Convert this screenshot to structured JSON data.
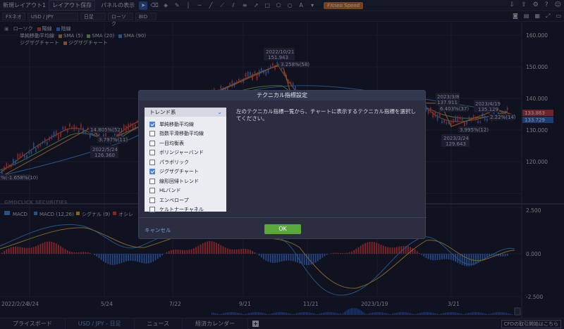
{
  "toolbar": {
    "layout_name": "新規レイアウト1",
    "save_layout": "レイアウト保存",
    "panel_display": "パネルの表示",
    "fxneo_speed": "FXneo Speed",
    "tools": [
      "cursor-icon",
      "eraser-icon",
      "paint-icon",
      "draw-icon",
      "vline-icon",
      "hline-icon",
      "trendline-icon",
      "ray-icon",
      "channel-icon",
      "parallel-icon",
      "arrow-icon",
      "rect-icon",
      "pentagon-icon",
      "circle-icon",
      "text-icon",
      "chevron-down-icon"
    ],
    "right_icons": [
      "download-icon",
      "share-icon",
      "gear-icon",
      "question-icon",
      "user-icon"
    ]
  },
  "subbar": {
    "product": "FXネオ",
    "pair": "USD / JPY",
    "period": "日足",
    "chart_type": "ローソク",
    "price_type": "BID"
  },
  "legend": {
    "row1": [
      {
        "label": "ローソク",
        "color": ""
      },
      {
        "label": "陽線",
        "color": "#e23b3b"
      },
      {
        "label": "陰線",
        "color": "#3b78e2"
      }
    ],
    "row2": [
      {
        "label": "単純移動平均線",
        "color": ""
      },
      {
        "label": "SMA (5)",
        "color": "#d98b3a"
      },
      {
        "label": "SMA (20)",
        "color": "#7fbf40"
      },
      {
        "label": "SMA (90)",
        "color": "#3f8fd8"
      }
    ],
    "row3": [
      {
        "label": "ジグザグチャート",
        "color": ""
      },
      {
        "label": "ジグザグチャート",
        "color": "#e0883a"
      }
    ]
  },
  "price_axis": [
    "160.000",
    "150.000",
    "140.000",
    "130.000",
    "120.000"
  ],
  "macd_axis": [
    "2.500",
    "0.000",
    "-2.500"
  ],
  "price_tags": [
    "133.863",
    "133.729"
  ],
  "date_axis": [
    "2022/2/24",
    "3/24",
    "5/24",
    "7/22",
    "9/21",
    "11/21",
    "2023/1/19",
    "3/21"
  ],
  "annotations": {
    "peak_date": "2022/10/21",
    "peak_value": "151.943",
    "peak_pct": "3.258%(58)",
    "low_date": "2022/5/24",
    "low_value": "126.360",
    "pct_a": "14.805%(52)",
    "pct_b": "3.797%(11)",
    "left_pct": "%(-1.658%(10)",
    "mar8_date": "2023/3/8",
    "mar8_value": "137.911",
    "pct_c": "6.403%(37)",
    "apr19_date": "2023/4/19",
    "apr19_value": "135.129",
    "mar24_date": "2023/3/24",
    "mar24_value": "129.643",
    "pct_d": "3.995%(12)",
    "pct_e": "2.22%(14)"
  },
  "macd_legend": [
    {
      "label": "MACD",
      "color": ""
    },
    {
      "label": "MACD (12,26)",
      "color": "#3f8fd8"
    },
    {
      "label": "シグナル (9)",
      "color": "#d9b33a"
    },
    {
      "label": "オシレ",
      "color": "#e23b3b"
    }
  ],
  "watermark": "GMOCLICK SECURITIES",
  "modal": {
    "title": "テクニカル指標設定",
    "category": "トレンド系",
    "description": "左のテクニカル指標一覧から、チャートに表示するテクニカル指標を選択してください。",
    "indicators": [
      {
        "label": "単純移動平均線",
        "checked": true
      },
      {
        "label": "指数平滑移動平均線",
        "checked": false
      },
      {
        "label": "一目均衡表",
        "checked": false
      },
      {
        "label": "ボリンジャーバンド",
        "checked": false
      },
      {
        "label": "パラボリック",
        "checked": false
      },
      {
        "label": "ジグザグチャート",
        "checked": true
      },
      {
        "label": "線形回帰トレンド",
        "checked": false
      },
      {
        "label": "HLバンド",
        "checked": false
      },
      {
        "label": "エンベロープ",
        "checked": false
      },
      {
        "label": "ケルトナーチャネル",
        "checked": false
      }
    ],
    "cancel": "キャンセル",
    "ok": "OK"
  },
  "bottom": {
    "tabs": [
      "プライスボード",
      "USD / JPY - 日足",
      "ニュース",
      "経済カレンダー"
    ],
    "right_label": "CFDの取引開始はこちら"
  }
}
